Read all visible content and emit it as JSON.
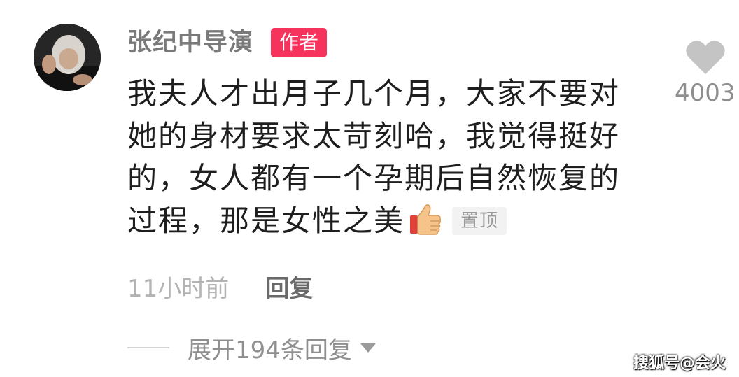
{
  "comment": {
    "username": "张纪中导演",
    "author_badge": "作者",
    "text": "我夫人才出月子几个月，大家不要对她的身材要求太苛刻哈，我觉得挺好的，女人都有一个孕期后自然恢复的过程，那是女性之美",
    "emoji": "thumbs-up-icon",
    "pin_label": "置顶",
    "timestamp": "11小时前",
    "reply_label": "回复",
    "like_count": "4003",
    "expand_replies_label": "展开194条回复"
  },
  "watermark": "搜狐号@会火",
  "colors": {
    "author_badge_bg": "#f6335d",
    "like_icon": "#c4c4c4",
    "username": "#7a7a7a",
    "comment_text": "#1e1e1e",
    "timestamp": "#b3b3b3"
  }
}
